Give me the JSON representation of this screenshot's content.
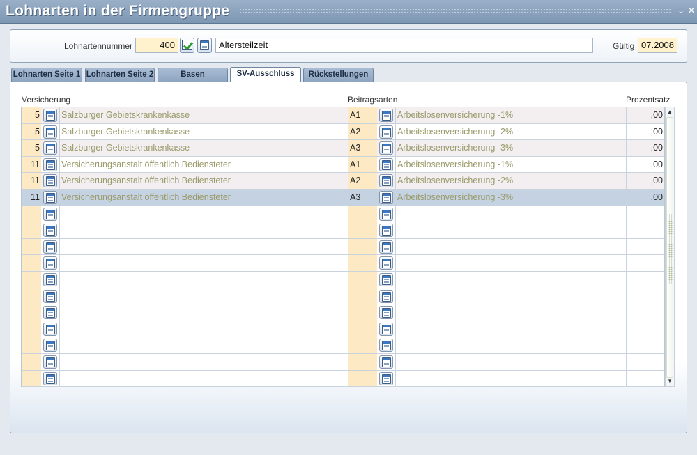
{
  "window": {
    "title": "Lohnarten in der Firmengruppe",
    "minimize_glyph": "⌄",
    "close_glyph": "✕"
  },
  "header": {
    "lohnartennummer_label": "Lohnartennummer",
    "lohnartennummer_value": "400",
    "bezeichnung_value": "Altersteilzeit",
    "gueltig_label": "Gültig",
    "gueltig_value": "07.2008"
  },
  "tabs": [
    {
      "label": "Lohnarten Seite 1",
      "active": false
    },
    {
      "label": "Lohnarten Seite 2",
      "active": false
    },
    {
      "label": "Basen",
      "active": false
    },
    {
      "label": "SV-Ausschluss",
      "active": true
    },
    {
      "label": "Rückstellungen",
      "active": false
    }
  ],
  "grid": {
    "columns": {
      "versicherung": "Versicherung",
      "beitragsarten": "Beitragsarten",
      "prozentsatz": "Prozentsatz"
    },
    "rows": [
      {
        "nr": "5",
        "versicherung": "Salzburger Gebietskrankenkasse",
        "code": "A1",
        "beitragsart": "Arbeitslosenversicherung -1%",
        "prozent": ",00"
      },
      {
        "nr": "5",
        "versicherung": "Salzburger Gebietskrankenkasse",
        "code": "A2",
        "beitragsart": "Arbeitslosenversicherung -2%",
        "prozent": ",00"
      },
      {
        "nr": "5",
        "versicherung": "Salzburger Gebietskrankenkasse",
        "code": "A3",
        "beitragsart": "Arbeitslosenversicherung -3%",
        "prozent": ",00"
      },
      {
        "nr": "11",
        "versicherung": "Versicherungsanstalt öffentlich Bediensteter",
        "code": "A1",
        "beitragsart": "Arbeitslosenversicherung -1%",
        "prozent": ",00"
      },
      {
        "nr": "11",
        "versicherung": "Versicherungsanstalt öffentlich Bediensteter",
        "code": "A2",
        "beitragsart": "Arbeitslosenversicherung -2%",
        "prozent": ",00"
      },
      {
        "nr": "11",
        "versicherung": "Versicherungsanstalt öffentlich Bediensteter",
        "code": "A3",
        "beitragsart": "Arbeitslosenversicherung -3%",
        "prozent": ",00"
      },
      {
        "nr": "",
        "versicherung": "",
        "code": "",
        "beitragsart": "",
        "prozent": ""
      },
      {
        "nr": "",
        "versicherung": "",
        "code": "",
        "beitragsart": "",
        "prozent": ""
      },
      {
        "nr": "",
        "versicherung": "",
        "code": "",
        "beitragsart": "",
        "prozent": ""
      },
      {
        "nr": "",
        "versicherung": "",
        "code": "",
        "beitragsart": "",
        "prozent": ""
      },
      {
        "nr": "",
        "versicherung": "",
        "code": "",
        "beitragsart": "",
        "prozent": ""
      },
      {
        "nr": "",
        "versicherung": "",
        "code": "",
        "beitragsart": "",
        "prozent": ""
      },
      {
        "nr": "",
        "versicherung": "",
        "code": "",
        "beitragsart": "",
        "prozent": ""
      },
      {
        "nr": "",
        "versicherung": "",
        "code": "",
        "beitragsart": "",
        "prozent": ""
      },
      {
        "nr": "",
        "versicherung": "",
        "code": "",
        "beitragsart": "",
        "prozent": ""
      },
      {
        "nr": "",
        "versicherung": "",
        "code": "",
        "beitragsart": "",
        "prozent": ""
      },
      {
        "nr": "",
        "versicherung": "",
        "code": "",
        "beitragsart": "",
        "prozent": ""
      }
    ],
    "selected_row": 5
  },
  "scrollbar": {
    "up_glyph": "▲",
    "down_glyph": "▼"
  },
  "icons": {
    "list_icon": "document-list-icon",
    "confirm_icon": "check-icon"
  },
  "colors": {
    "accent": "#7d96b2",
    "key_field": "#fde9c4",
    "selected_row": "#c4d2e1",
    "muted_text": "#9a9a6a"
  }
}
